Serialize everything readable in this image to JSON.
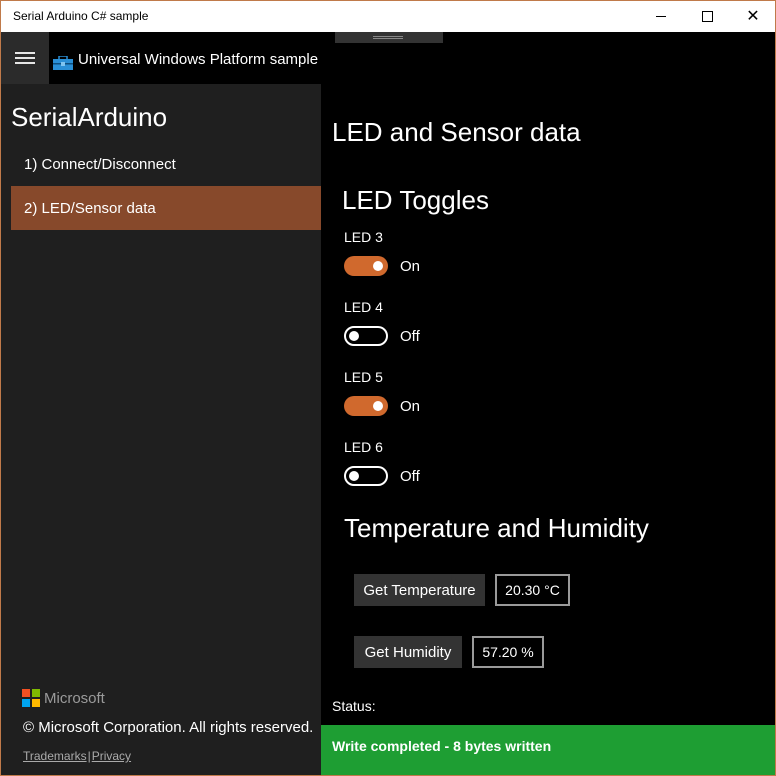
{
  "window": {
    "title": "Serial Arduino C# sample",
    "controls": {
      "minimize": "minimize-icon",
      "maximize": "maximize-icon",
      "close": "close-icon"
    }
  },
  "app": {
    "header_title": "Universal Windows Platform sample",
    "toolbox_icon": "toolbox-icon",
    "accent_color": "#d0692d"
  },
  "sidebar": {
    "heading": "SerialArduino",
    "items": [
      {
        "label": "1) Connect/Disconnect",
        "selected": false
      },
      {
        "label": "2) LED/Sensor data",
        "selected": true
      }
    ],
    "logo_text": "Microsoft",
    "copyright": "© Microsoft Corporation. All rights reserved.",
    "links": {
      "trademarks": "Trademarks",
      "separator": "|",
      "privacy": "Privacy"
    }
  },
  "main": {
    "title": "LED and Sensor data",
    "led_section": {
      "title": "LED Toggles",
      "leds": [
        {
          "label": "LED 3",
          "state": "On",
          "on": true
        },
        {
          "label": "LED 4",
          "state": "Off",
          "on": false
        },
        {
          "label": "LED 5",
          "state": "On",
          "on": true
        },
        {
          "label": "LED 6",
          "state": "Off",
          "on": false
        }
      ]
    },
    "sensor_section": {
      "title": "Temperature and Humidity",
      "temperature": {
        "button": "Get Temperature",
        "value": "20.30 °C"
      },
      "humidity": {
        "button": "Get Humidity",
        "value": "57.20 %"
      }
    },
    "status": {
      "label": "Status:",
      "message": "Write completed - 8 bytes written",
      "color": "#1e9e33"
    }
  }
}
